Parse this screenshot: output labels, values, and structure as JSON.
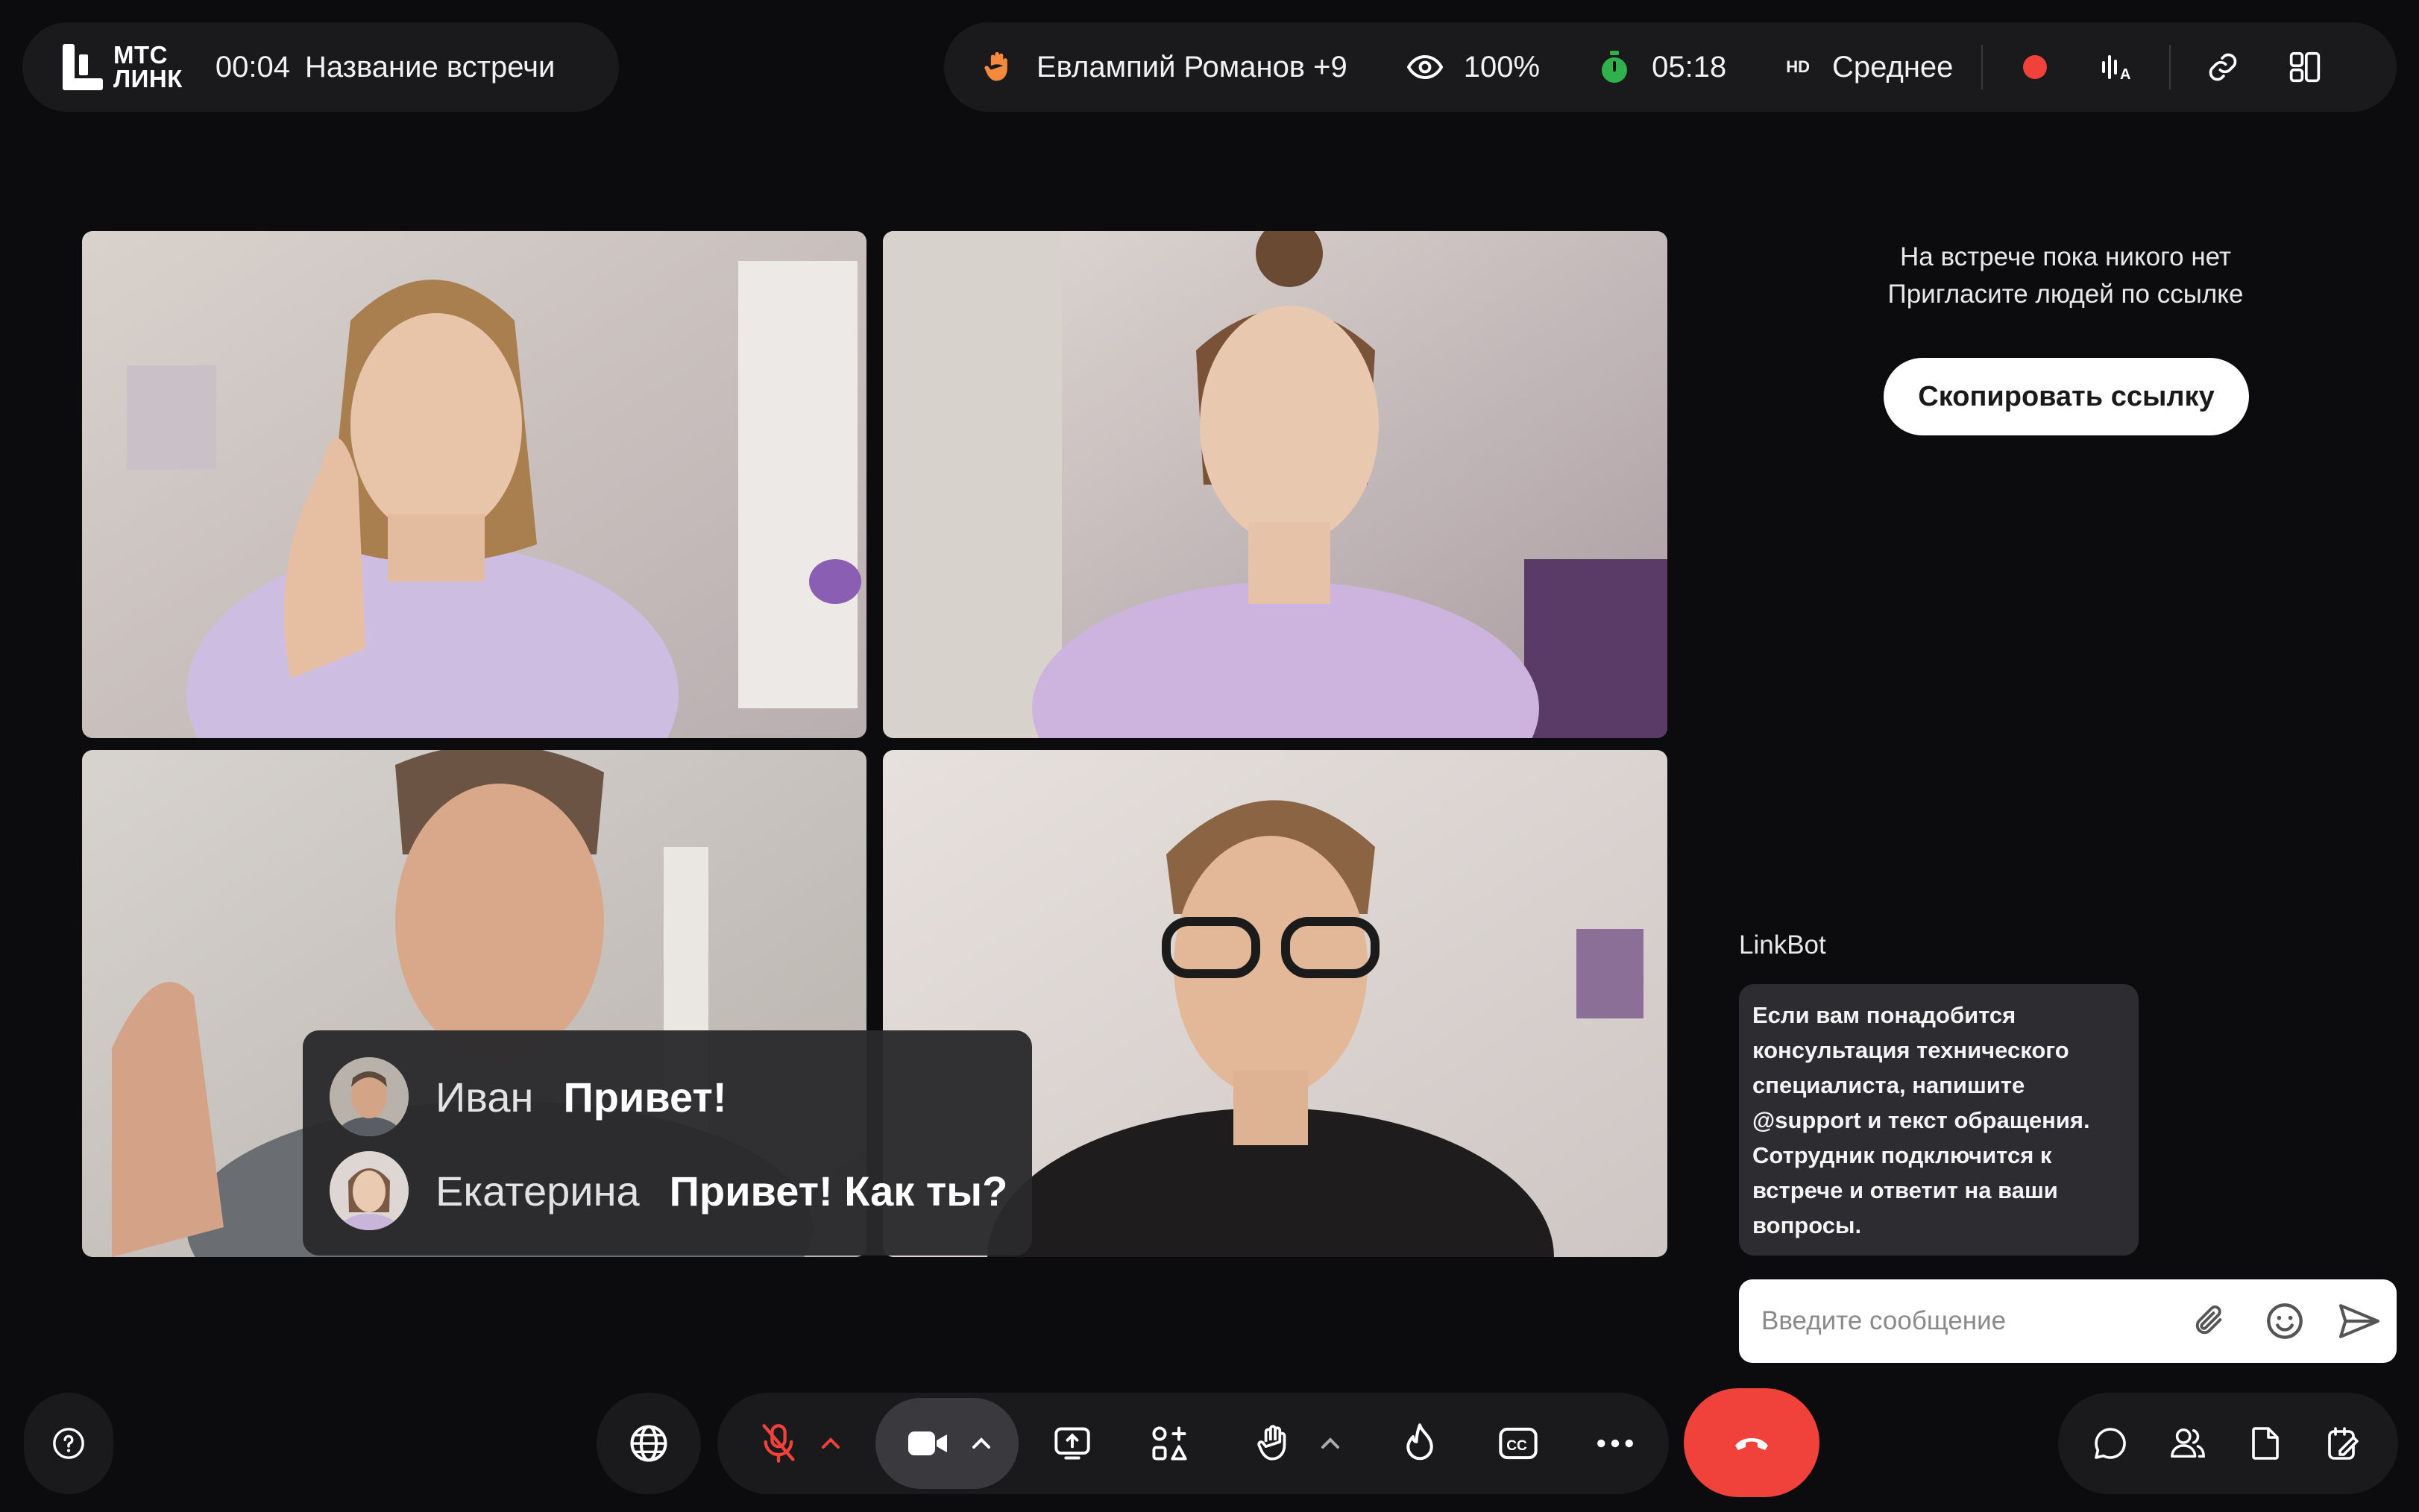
{
  "header": {
    "logo_line1": "МТС",
    "logo_line2": "ЛИНК",
    "elapsed": "00:04",
    "meeting_title": "Название встречи",
    "raised_hands": "Евлампий Романов +9",
    "visibility": "100%",
    "countdown": "05:18",
    "quality_badge": "HD",
    "quality": "Среднее"
  },
  "participants": [
    {
      "name": "participant-1"
    },
    {
      "name": "participant-2"
    },
    {
      "name": "participant-3"
    },
    {
      "name": "participant-4"
    }
  ],
  "captions": [
    {
      "speaker": "Иван",
      "text": "Привет!"
    },
    {
      "speaker": "Екатерина",
      "text": "Привет! Как ты?"
    }
  ],
  "side": {
    "empty_line1": "На встрече пока никого нет",
    "empty_line2": "Пригласите людей по ссылке",
    "copy_link": "Скопировать ссылку"
  },
  "chat": {
    "bot_name": "LinkBot",
    "bot_message": "Если вам понадобится консультация технического специалиста, напишите @support и текст обращения. Сотрудник подключится к встрече и ответит на ваши вопросы.",
    "input_placeholder": "Введите сообщение"
  },
  "colors": {
    "background": "#0c0c0e",
    "panel": "#1a1a1d",
    "end_call": "#f0413b",
    "record": "#f0413b",
    "hand": "#f58a3c",
    "timer_green": "#2fb24c",
    "mic_muted": "#f0413b"
  },
  "icons": [
    "hand-icon",
    "eye-icon",
    "stopwatch-icon",
    "record-icon",
    "voice-icon",
    "link-icon",
    "layout-icon",
    "help-icon",
    "globe-icon",
    "mic-off-icon",
    "camera-icon",
    "screen-share-icon",
    "apps-icon",
    "raise-hand-icon",
    "reaction-icon",
    "captions-icon",
    "more-icon",
    "end-call-icon",
    "chat-icon",
    "participants-icon",
    "files-icon",
    "notes-icon",
    "attach-icon",
    "emoji-icon",
    "send-icon"
  ]
}
